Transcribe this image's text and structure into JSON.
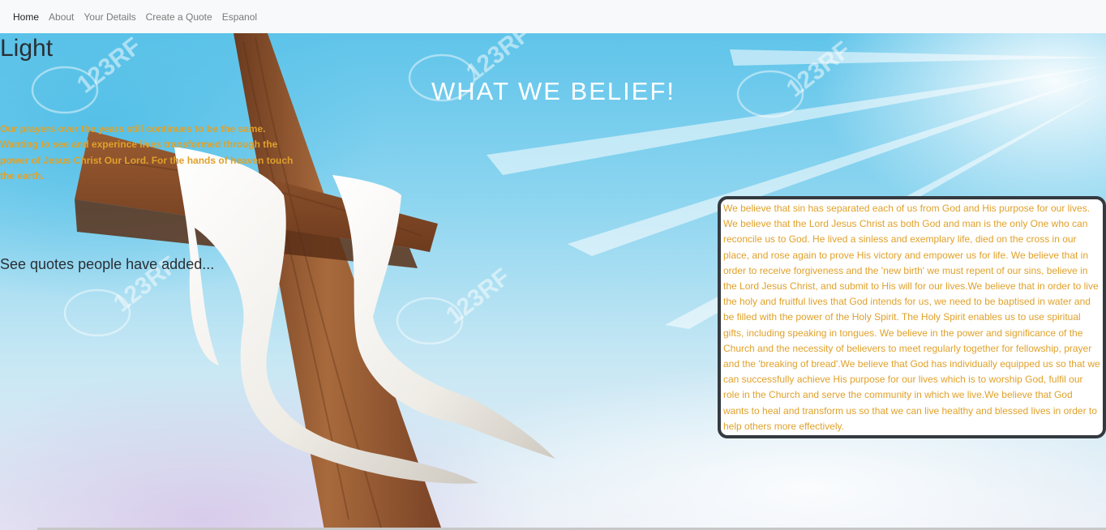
{
  "nav": {
    "items": [
      {
        "label": "Home",
        "active": true
      },
      {
        "label": "About",
        "active": false
      },
      {
        "label": "Your Details",
        "active": false
      },
      {
        "label": "Create a Quote",
        "active": false
      },
      {
        "label": "Espanol",
        "active": false
      }
    ]
  },
  "hero": {
    "brand": "Light",
    "headline": "WHAT WE BELIEF!",
    "prayer_text": "Our prayers over the years still continues to be the same. Wanting to see and experince lives transformed through the power of Jesus Christ Our Lord. For the hands of heaven touch the earth.",
    "quotes_link": "See quotes people have added...",
    "belief_text": "We believe that sin has separated each of us from God and His purpose for our lives. We believe that the Lord Jesus Christ as both God and man is the only One who can reconcile us to God. He lived a sinless and exemplary life, died on the cross in our place, and rose again to prove His victory and empower us for life. We believe that in order to receive forgiveness and the 'new birth' we must repent of our sins, believe in the Lord Jesus Christ, and submit to His will for our lives.We believe that in order to live the holy and fruitful lives that God intends for us, we need to be baptised in water and be filled with the power of the Holy Spirit. The Holy Spirit enables us to use spiritual gifts, including speaking in tongues. We believe in the power and significance of the Church and the necessity of believers to meet regularly together for fellowship, prayer and the 'breaking of bread'.We believe that God has individually equipped us so that we can successfully achieve His purpose for our lives which is to worship God, fulfil our role in the Church and serve the community in which we live.We believe that God wants to heal and transform us so that we can live healthy and blessed lives in order to help others more effectively.",
    "watermark": "123RF"
  },
  "colors": {
    "accent_text": "#e0a12a",
    "navbar_bg": "#f8f9fa",
    "box_border": "#343a40"
  }
}
